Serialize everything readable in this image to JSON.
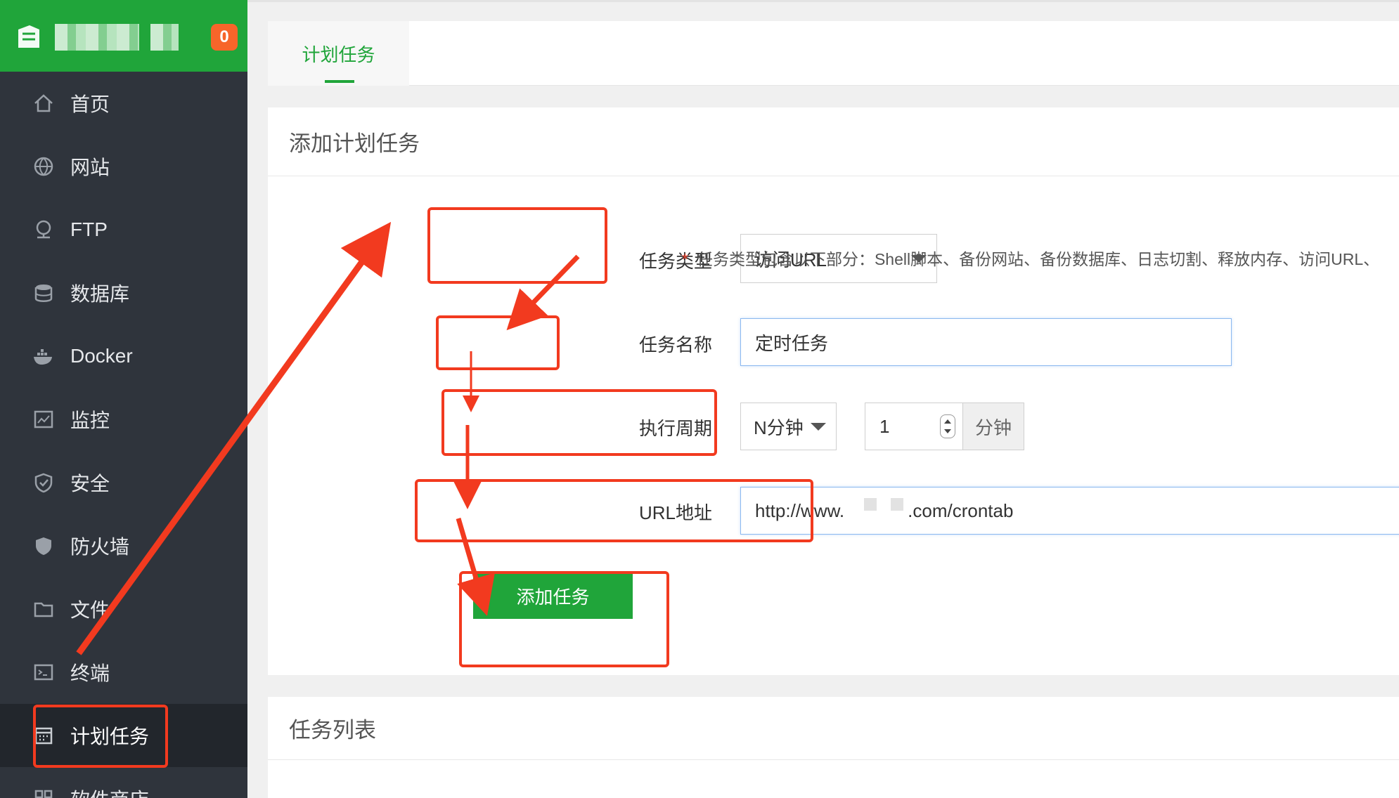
{
  "sidebar": {
    "badge": "0",
    "items": [
      {
        "label": "首页",
        "icon": "home-icon"
      },
      {
        "label": "网站",
        "icon": "globe-icon"
      },
      {
        "label": "FTP",
        "icon": "ftp-icon"
      },
      {
        "label": "数据库",
        "icon": "database-icon"
      },
      {
        "label": "Docker",
        "icon": "docker-icon"
      },
      {
        "label": "监控",
        "icon": "monitor-icon"
      },
      {
        "label": "安全",
        "icon": "shield-icon"
      },
      {
        "label": "防火墙",
        "icon": "firewall-icon"
      },
      {
        "label": "文件",
        "icon": "folder-icon"
      },
      {
        "label": "终端",
        "icon": "terminal-icon"
      },
      {
        "label": "计划任务",
        "icon": "calendar-icon"
      },
      {
        "label": "软件商店",
        "icon": "store-icon"
      }
    ],
    "active": "计划任务"
  },
  "tabs": {
    "active_label": "计划任务"
  },
  "add_panel": {
    "title": "添加计划任务",
    "task_type_label": "任务类型",
    "task_type_value": "访问URL",
    "hint_star": "*",
    "hint_text": "任务类型包含以下部分：Shell脚本、备份网站、备份数据库、日志切割、释放内存、访问URL、",
    "task_name_label": "任务名称",
    "task_name_value": "定时任务",
    "period_label": "执行周期",
    "period_type": "N分钟",
    "period_value": "1",
    "period_unit": "分钟",
    "url_label": "URL地址",
    "url_prefix": "http://www.",
    "url_suffix": ".com/crontab",
    "submit_label": "添加任务"
  },
  "list_panel": {
    "title": "任务列表"
  },
  "colors": {
    "brand": "#20a53a",
    "sidebar_bg": "#2f343c",
    "annotation": "#f23a1f",
    "badge": "#f7652a"
  }
}
